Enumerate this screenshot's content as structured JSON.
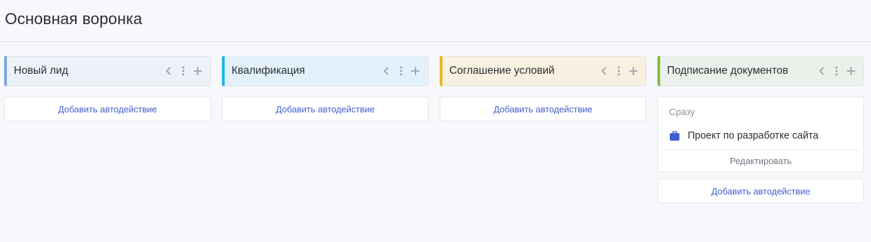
{
  "page": {
    "title": "Основная воронка"
  },
  "columns": [
    {
      "title": "Новый лид",
      "accent": "#7fa6d6",
      "bg": "#edf1f8",
      "add_label": "Добавить автодействие"
    },
    {
      "title": "Квалификация",
      "accent": "#1fb6e8",
      "bg": "#e3f1fa",
      "add_label": "Добавить автодействие"
    },
    {
      "title": "Соглашение условий",
      "accent": "#f2b21b",
      "bg": "#f8f0e1",
      "add_label": "Добавить автодействие"
    },
    {
      "title": "Подписание документов",
      "accent": "#7fbf3f",
      "bg": "#ebf0ea",
      "add_label": "Добавить автодействие",
      "action": {
        "when": "Сразу",
        "name": "Проект по разработке сайта",
        "icon": "briefcase-icon",
        "edit_label": "Редактировать"
      }
    }
  ],
  "icons": {
    "move_left": "chevron-left-icon",
    "more": "more-vertical-icon",
    "add": "plus-icon"
  },
  "colors": {
    "link": "#3f5fd0",
    "case_icon": "#3f5fd0"
  }
}
